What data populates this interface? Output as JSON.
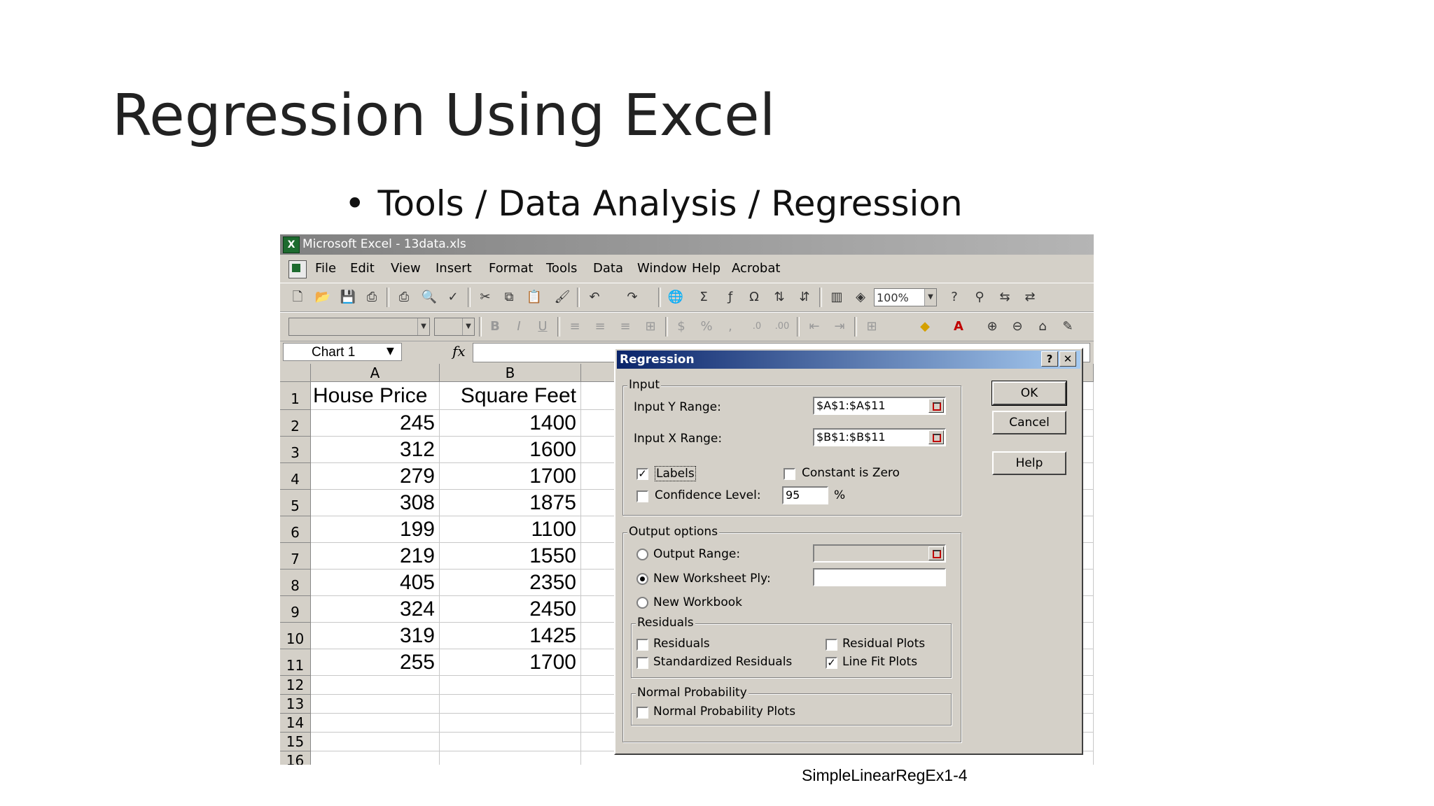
{
  "slide": {
    "title": "Regression Using Excel",
    "bullet": "Tools / Data Analysis / Regression",
    "footer": "SimpleLinearRegEx1-4"
  },
  "excel": {
    "window_title": "Microsoft Excel - 13data.xls",
    "menu": [
      "File",
      "Edit",
      "View",
      "Insert",
      "Format",
      "Tools",
      "Data",
      "Window",
      "Help",
      "Acrobat"
    ],
    "zoom": "100%",
    "name_box": "Chart 1",
    "fx_label": "fx",
    "columns": [
      "A",
      "B"
    ],
    "rows": [
      "1",
      "2",
      "3",
      "4",
      "5",
      "6",
      "7",
      "8",
      "9",
      "10",
      "11",
      "12",
      "13",
      "14",
      "15",
      "16"
    ],
    "headers": {
      "a": "House Price",
      "b": "Square Feet"
    },
    "data": [
      {
        "a": "245",
        "b": "1400"
      },
      {
        "a": "312",
        "b": "1600"
      },
      {
        "a": "279",
        "b": "1700"
      },
      {
        "a": "308",
        "b": "1875"
      },
      {
        "a": "199",
        "b": "1100"
      },
      {
        "a": "219",
        "b": "1550"
      },
      {
        "a": "405",
        "b": "2350"
      },
      {
        "a": "324",
        "b": "2450"
      },
      {
        "a": "319",
        "b": "1425"
      },
      {
        "a": "255",
        "b": "1700"
      }
    ]
  },
  "dialog": {
    "title": "Regression",
    "help_btn": "?",
    "close_btn": "✕",
    "input_group": "Input",
    "y_range_label": "Input Y Range:",
    "y_range_value": "$A$1:$A$11",
    "x_range_label": "Input X Range:",
    "x_range_value": "$B$1:$B$11",
    "labels_label": "Labels",
    "labels_checked": true,
    "constant_zero_label": "Constant is Zero",
    "confidence_label": "Confidence Level:",
    "confidence_value": "95",
    "percent": "%",
    "output_group": "Output options",
    "output_range_label": "Output Range:",
    "new_ply_label": "New Worksheet Ply:",
    "new_workbook_label": "New Workbook",
    "output_selected": "new_ply",
    "residuals_group": "Residuals",
    "residuals_label": "Residuals",
    "std_residuals_label": "Standardized Residuals",
    "residual_plots_label": "Residual Plots",
    "line_fit_label": "Line Fit Plots",
    "line_fit_checked": true,
    "normal_group": "Normal Probability",
    "normal_plots_label": "Normal Probability Plots",
    "ok": "OK",
    "cancel": "Cancel",
    "help": "Help"
  }
}
